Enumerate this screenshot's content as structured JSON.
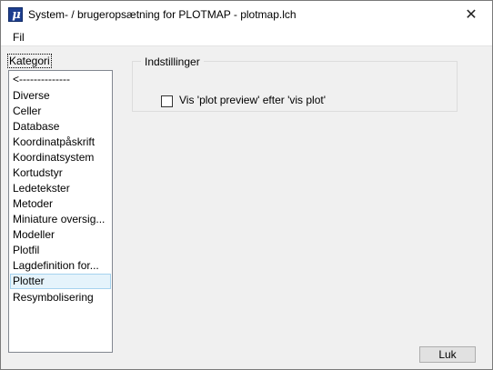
{
  "window": {
    "title": "System- / brugeropsætning for PLOTMAP - plotmap.lch",
    "close_glyph": "✕",
    "app_icon_letter": "μ"
  },
  "menubar": {
    "items": [
      "Fil"
    ]
  },
  "kategori": {
    "label": "Kategori",
    "items": [
      "<--------------",
      "Diverse",
      "Celler",
      "Database",
      "Koordinatpåskrift",
      "Koordinatsystem",
      "Kortudstyr",
      "Ledetekster",
      "Metoder",
      "Miniature oversig...",
      "Modeller",
      "Plotfil",
      "Lagdefinition for...",
      "Plotter",
      "Resymbolisering"
    ],
    "selected": "Plotter"
  },
  "settings": {
    "group_title": "Indstillinger",
    "checkbox_label": "Vis 'plot preview' efter 'vis plot'",
    "checkbox_checked": false
  },
  "footer": {
    "close_button": "Luk"
  }
}
